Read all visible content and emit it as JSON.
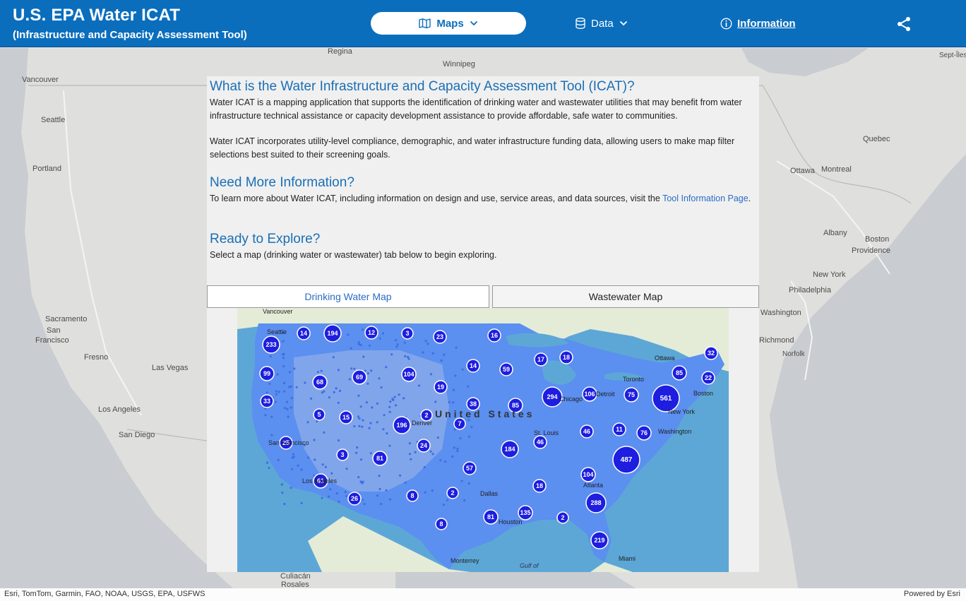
{
  "header": {
    "title": "U.S. EPA Water ICAT",
    "subtitle": "(Infrastructure and Capacity Assessment Tool)",
    "nav": {
      "maps": "Maps",
      "data": "Data",
      "information": "Information"
    }
  },
  "basemap": {
    "cities": [
      {
        "name": "Regina"
      },
      {
        "name": "Winnipeg"
      },
      {
        "name": "Vancouver"
      },
      {
        "name": "Seattle"
      },
      {
        "name": "Portland"
      },
      {
        "name": "Sacramento"
      },
      {
        "name": "San"
      },
      {
        "name": "Francisco"
      },
      {
        "name": "Fresno"
      },
      {
        "name": "Las Vegas"
      },
      {
        "name": "Los Angeles"
      },
      {
        "name": "San Diego"
      },
      {
        "name": "Quebec"
      },
      {
        "name": "Ottawa"
      },
      {
        "name": "Montreal"
      },
      {
        "name": "Albany"
      },
      {
        "name": "Boston"
      },
      {
        "name": "Providence"
      },
      {
        "name": "New York"
      },
      {
        "name": "Philadelphia"
      },
      {
        "name": "Washington"
      },
      {
        "name": "Richmond"
      },
      {
        "name": "Norfolk"
      },
      {
        "name": "Culiacán"
      },
      {
        "name": "Rosales"
      },
      {
        "name": "Sept-Îles"
      }
    ],
    "attribution": "Esri, TomTom, Garmin, FAO, NOAA, USGS, EPA, USFWS",
    "powered_by": "Powered by Esri"
  },
  "panel": {
    "h1": "What is the Water Infrastructure and Capacity Assessment Tool (ICAT)?",
    "p1": "Water ICAT is a mapping application that supports the identification of drinking water and wastewater utilities that may benefit from water infrastructure technical assistance or capacity development assistance to provide affordable, safe water to communities.",
    "p2": "Water ICAT incorporates utility-level compliance, demographic, and water infrastructure funding data, allowing users to make map filter selections best suited to their screening goals.",
    "h2": "Need More Information?",
    "p3_pre": "To learn more about Water ICAT, including information on design and use, service areas, and data sources, visit the ",
    "p3_link": "Tool Information Page",
    "p3_post": ".",
    "h3": "Ready to Explore?",
    "p4": "Select a map (drinking water or wastewater) tab below to begin exploring.",
    "tabs": {
      "drinking_water": "Drinking Water Map",
      "wastewater": "Wastewater Map"
    }
  },
  "preview": {
    "labels": [
      "Vancouver",
      "Seattle",
      "Ottawa",
      "Toronto",
      "Detroit",
      "Chicago",
      "Boston",
      "New York",
      "Washington",
      "Denver",
      "United States",
      "St. Louis",
      "San Francisco",
      "Los Angeles",
      "Dallas",
      "Atlanta",
      "Houston",
      "Miami",
      "Monterrey",
      "Gulf of"
    ],
    "clusters": [
      {
        "v": "14"
      },
      {
        "v": "194"
      },
      {
        "v": "12"
      },
      {
        "v": "3"
      },
      {
        "v": "23"
      },
      {
        "v": "16"
      },
      {
        "v": "233"
      },
      {
        "v": "14"
      },
      {
        "v": "59"
      },
      {
        "v": "17"
      },
      {
        "v": "18"
      },
      {
        "v": "32"
      },
      {
        "v": "99"
      },
      {
        "v": "68"
      },
      {
        "v": "69"
      },
      {
        "v": "104"
      },
      {
        "v": "19"
      },
      {
        "v": "85"
      },
      {
        "v": "22"
      },
      {
        "v": "294"
      },
      {
        "v": "106"
      },
      {
        "v": "75"
      },
      {
        "v": "561"
      },
      {
        "v": "33"
      },
      {
        "v": "5"
      },
      {
        "v": "15"
      },
      {
        "v": "2"
      },
      {
        "v": "38"
      },
      {
        "v": "85"
      },
      {
        "v": "196"
      },
      {
        "v": "7"
      },
      {
        "v": "46"
      },
      {
        "v": "11"
      },
      {
        "v": "76"
      },
      {
        "v": "25"
      },
      {
        "v": "24"
      },
      {
        "v": "46"
      },
      {
        "v": "184"
      },
      {
        "v": "3"
      },
      {
        "v": "81"
      },
      {
        "v": "57"
      },
      {
        "v": "487"
      },
      {
        "v": "61"
      },
      {
        "v": "104"
      },
      {
        "v": "18"
      },
      {
        "v": "2"
      },
      {
        "v": "8"
      },
      {
        "v": "26"
      },
      {
        "v": "288"
      },
      {
        "v": "135"
      },
      {
        "v": "81"
      },
      {
        "v": "2"
      },
      {
        "v": "8"
      },
      {
        "v": "219"
      }
    ]
  },
  "colors": {
    "header_bg": "#0a6ebd",
    "accent": "#1a6fb5",
    "cluster": "#1e1ee0",
    "service_area": "#5b8ff0"
  }
}
